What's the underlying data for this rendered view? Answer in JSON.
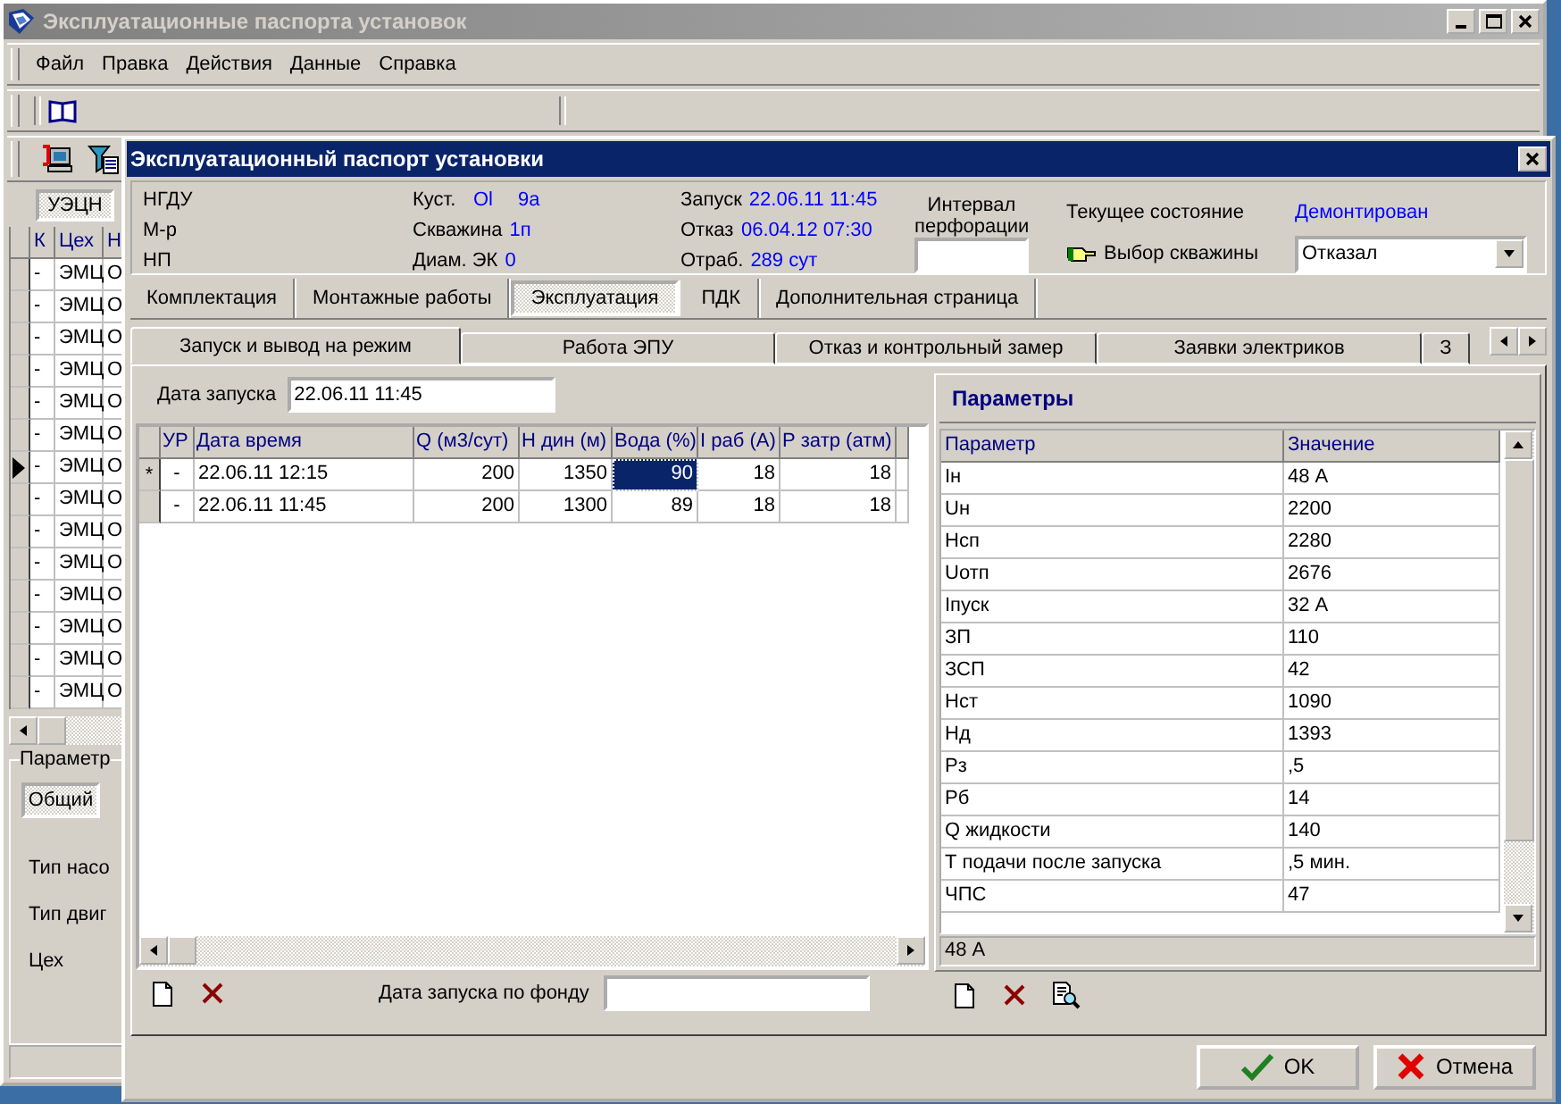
{
  "main_window": {
    "title": "Эксплуатационные паспорта установок",
    "menu": [
      "Файл",
      "Правка",
      "Действия",
      "Данные",
      "Справка"
    ],
    "mode_button": {
      "label": "УЭЦН",
      "selected": true
    },
    "grid": {
      "columns": [
        "К",
        "Цех",
        "Н"
      ],
      "rows": [
        {
          "cells": [
            "-",
            "ЭМЦ",
            "О"
          ],
          "current": false
        },
        {
          "cells": [
            "-",
            "ЭМЦ",
            "О"
          ],
          "current": false
        },
        {
          "cells": [
            "-",
            "ЭМЦ",
            "О"
          ],
          "current": false
        },
        {
          "cells": [
            "-",
            "ЭМЦ",
            "О"
          ],
          "current": false
        },
        {
          "cells": [
            "-",
            "ЭМЦ",
            "О"
          ],
          "current": false
        },
        {
          "cells": [
            "-",
            "ЭМЦ",
            "О"
          ],
          "current": false
        },
        {
          "cells": [
            "-",
            "ЭМЦ",
            "О"
          ],
          "current": true
        },
        {
          "cells": [
            "-",
            "ЭМЦ",
            "О"
          ],
          "current": false
        },
        {
          "cells": [
            "-",
            "ЭМЦ",
            "О"
          ],
          "current": false
        },
        {
          "cells": [
            "-",
            "ЭМЦ",
            "О"
          ],
          "current": false
        },
        {
          "cells": [
            "-",
            "ЭМЦ",
            "О"
          ],
          "current": false
        },
        {
          "cells": [
            "-",
            "ЭМЦ",
            "О"
          ],
          "current": false
        },
        {
          "cells": [
            "-",
            "ЭМЦ",
            "О"
          ],
          "current": false
        },
        {
          "cells": [
            "-",
            "ЭМЦ",
            "О"
          ],
          "current": false
        }
      ]
    },
    "params_group": {
      "title": "Параметр",
      "tabs": [
        {
          "label": "Общий",
          "selected": true
        }
      ],
      "fields": [
        "Тип насо",
        "Тип двиг",
        "Цех"
      ]
    }
  },
  "dialog": {
    "title": "Эксплуатационный паспорт установки",
    "info_columns": [
      [
        {
          "label": "НГДУ"
        },
        {
          "label": "М-р"
        },
        {
          "label": "НП"
        }
      ],
      [
        {
          "label": "Куст.",
          "values": [
            "Ol",
            "9a"
          ]
        },
        {
          "label": "Скважина",
          "values": [
            "1п"
          ]
        },
        {
          "label": "Диам. ЭК",
          "values": [
            "0"
          ]
        }
      ],
      [
        {
          "label": "Запуск",
          "values": [
            "22.06.11 11:45"
          ]
        },
        {
          "label": "Отказ",
          "values": [
            "06.04.12 07:30"
          ]
        },
        {
          "label": "Отраб.",
          "values": [
            "289 сут"
          ]
        }
      ]
    ],
    "perforation": {
      "label": "Интервал перфорации"
    },
    "state": {
      "label": "Текущее состояние",
      "value": "Демонтирован",
      "well_button": "Выбор скважины",
      "combo": "Отказал"
    },
    "tabs": [
      {
        "label": "Комплектация",
        "selected": false
      },
      {
        "label": "Монтажные работы",
        "selected": false
      },
      {
        "label": "Эксплуатация",
        "selected": true
      },
      {
        "label": "ПДК",
        "selected": false
      },
      {
        "label": "Дополнительная страница",
        "selected": false
      }
    ],
    "subtabs": [
      {
        "label": "Запуск и вывод на режим",
        "selected": true
      },
      {
        "label": "Работа ЭПУ",
        "selected": false
      },
      {
        "label": "Отказ и контрольный замер",
        "selected": false
      },
      {
        "label": "Заявки электриков",
        "selected": false
      },
      {
        "label": "З",
        "selected": false
      }
    ],
    "launch_date": {
      "label": "Дата запуска",
      "value": "22.06.11 11:45"
    },
    "measurements": {
      "columns": [
        "УР",
        "Дата время",
        "Q (м3/сут)",
        "Н дин (м)",
        "Вода (%)",
        "I раб (А)",
        "Р затр (атм)"
      ],
      "rows": [
        {
          "indicator": "*",
          "cells": [
            {
              "text": "-",
              "selected": false
            },
            {
              "text": "22.06.11 12:15",
              "selected": false
            },
            {
              "text": "200",
              "selected": false
            },
            {
              "text": "1350",
              "selected": false
            },
            {
              "text": "90",
              "selected": true
            },
            {
              "text": "18",
              "selected": false
            },
            {
              "text": "18",
              "selected": false
            }
          ]
        },
        {
          "cells": [
            {
              "text": "-",
              "selected": false
            },
            {
              "text": "22.06.11 11:45",
              "selected": false
            },
            {
              "text": "200",
              "selected": false
            },
            {
              "text": "1300",
              "selected": false
            },
            {
              "text": "89",
              "selected": false
            },
            {
              "text": "18",
              "selected": false
            },
            {
              "text": "18",
              "selected": false
            }
          ]
        }
      ]
    },
    "fund_date": {
      "label": "Дата запуска по фонду"
    },
    "parameters": {
      "title": "Параметры",
      "columns": [
        "Параметр",
        "Значение"
      ],
      "rows": [
        [
          "Iн",
          "48 А"
        ],
        [
          "Uн",
          "2200"
        ],
        [
          "Нсп",
          "2280"
        ],
        [
          "Uотп",
          "2676"
        ],
        [
          "Iпуск",
          "32 А"
        ],
        [
          "ЗП",
          "110"
        ],
        [
          "ЗСП",
          "42"
        ],
        [
          "Нст",
          "1090"
        ],
        [
          "Нд",
          "1393"
        ],
        [
          "Рз",
          ",5"
        ],
        [
          "Рб",
          "14"
        ],
        [
          "Q жидкости",
          "140"
        ],
        [
          "Т подачи после запуска",
          ",5 мин."
        ],
        [
          "ЧПС",
          "47"
        ]
      ],
      "status": "48 А"
    },
    "buttons": [
      {
        "kind": "ok",
        "label": "OK"
      },
      {
        "kind": "cancel",
        "label": "Отмена"
      }
    ]
  }
}
